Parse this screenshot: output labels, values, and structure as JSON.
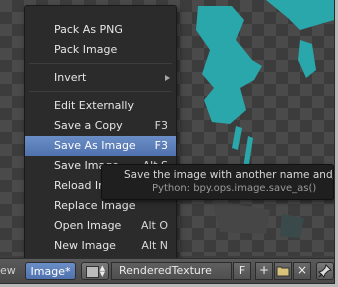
{
  "menu": {
    "items": [
      {
        "label": "Pack As PNG",
        "shortcut": ""
      },
      {
        "label": "Pack Image",
        "shortcut": ""
      },
      {
        "label": "Invert",
        "shortcut": ""
      },
      {
        "label": "Edit Externally",
        "shortcut": ""
      },
      {
        "label": "Save a Copy",
        "shortcut": "F3"
      },
      {
        "label": "Save As Image",
        "shortcut": "F3"
      },
      {
        "label": "Save Image",
        "shortcut": "Alt S"
      },
      {
        "label": "Reload Image",
        "shortcut": ""
      },
      {
        "label": "Replace Image",
        "shortcut": ""
      },
      {
        "label": "Open Image",
        "shortcut": "Alt O"
      },
      {
        "label": "New Image",
        "shortcut": "Alt N"
      }
    ]
  },
  "tooltip": {
    "description": "Save the image with another name and/or setti",
    "python": "Python: bpy.ops.image.save_as()"
  },
  "header": {
    "view_label": "ew",
    "image_menu_label": "Image*",
    "image_name": "RenderedTexture",
    "fake_user_label": "F",
    "new_icon": "+",
    "open_icon": "folder-icon",
    "unlink_icon": "×"
  },
  "colors": {
    "accent": "#5a7dbb",
    "menu_bg": "#2b2b2b",
    "teal": "#2aa7ab"
  }
}
